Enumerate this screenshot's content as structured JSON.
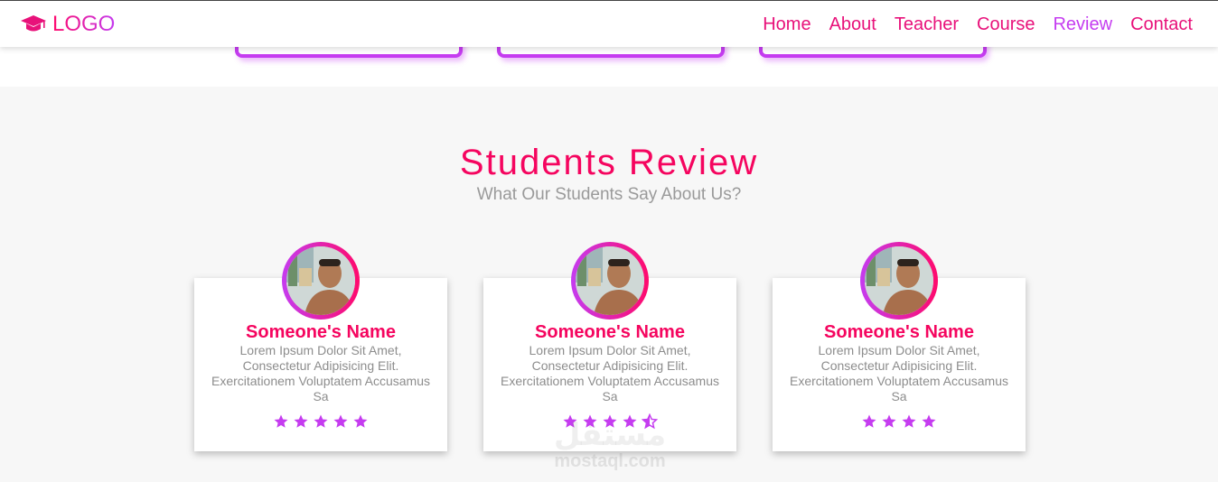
{
  "header": {
    "logo_text": "LOGO",
    "logo_icon": "graduation-cap-icon",
    "nav": [
      {
        "label": "Home"
      },
      {
        "label": "About"
      },
      {
        "label": "Teacher"
      },
      {
        "label": "Course"
      },
      {
        "label": "Review",
        "active": true
      },
      {
        "label": "Contact"
      }
    ]
  },
  "reviews": {
    "title": "Students Review",
    "subtitle": "What Our Students Say About Us?",
    "cards": [
      {
        "name": "Someone's Name",
        "text": "Lorem Ipsum Dolor Sit Amet, Consectetur Adipisicing Elit. Exercitationem Voluptatem Accusamus Sa",
        "rating": 5
      },
      {
        "name": "Someone's Name",
        "text": "Lorem Ipsum Dolor Sit Amet, Consectetur Adipisicing Elit. Exercitationem Voluptatem Accusamus Sa",
        "rating": 4.5
      },
      {
        "name": "Someone's Name",
        "text": "Lorem Ipsum Dolor Sit Amet, Consectetur Adipisicing Elit. Exercitationem Voluptatem Accusamus Sa",
        "rating": 4
      }
    ]
  },
  "watermark": {
    "arabic": "مستقل",
    "latin": "mostaql.com"
  },
  "colors": {
    "primary": "#f5055f",
    "accent": "#c53cf0",
    "muted": "#8d8d8d",
    "section_bg": "#f7f7f7"
  }
}
